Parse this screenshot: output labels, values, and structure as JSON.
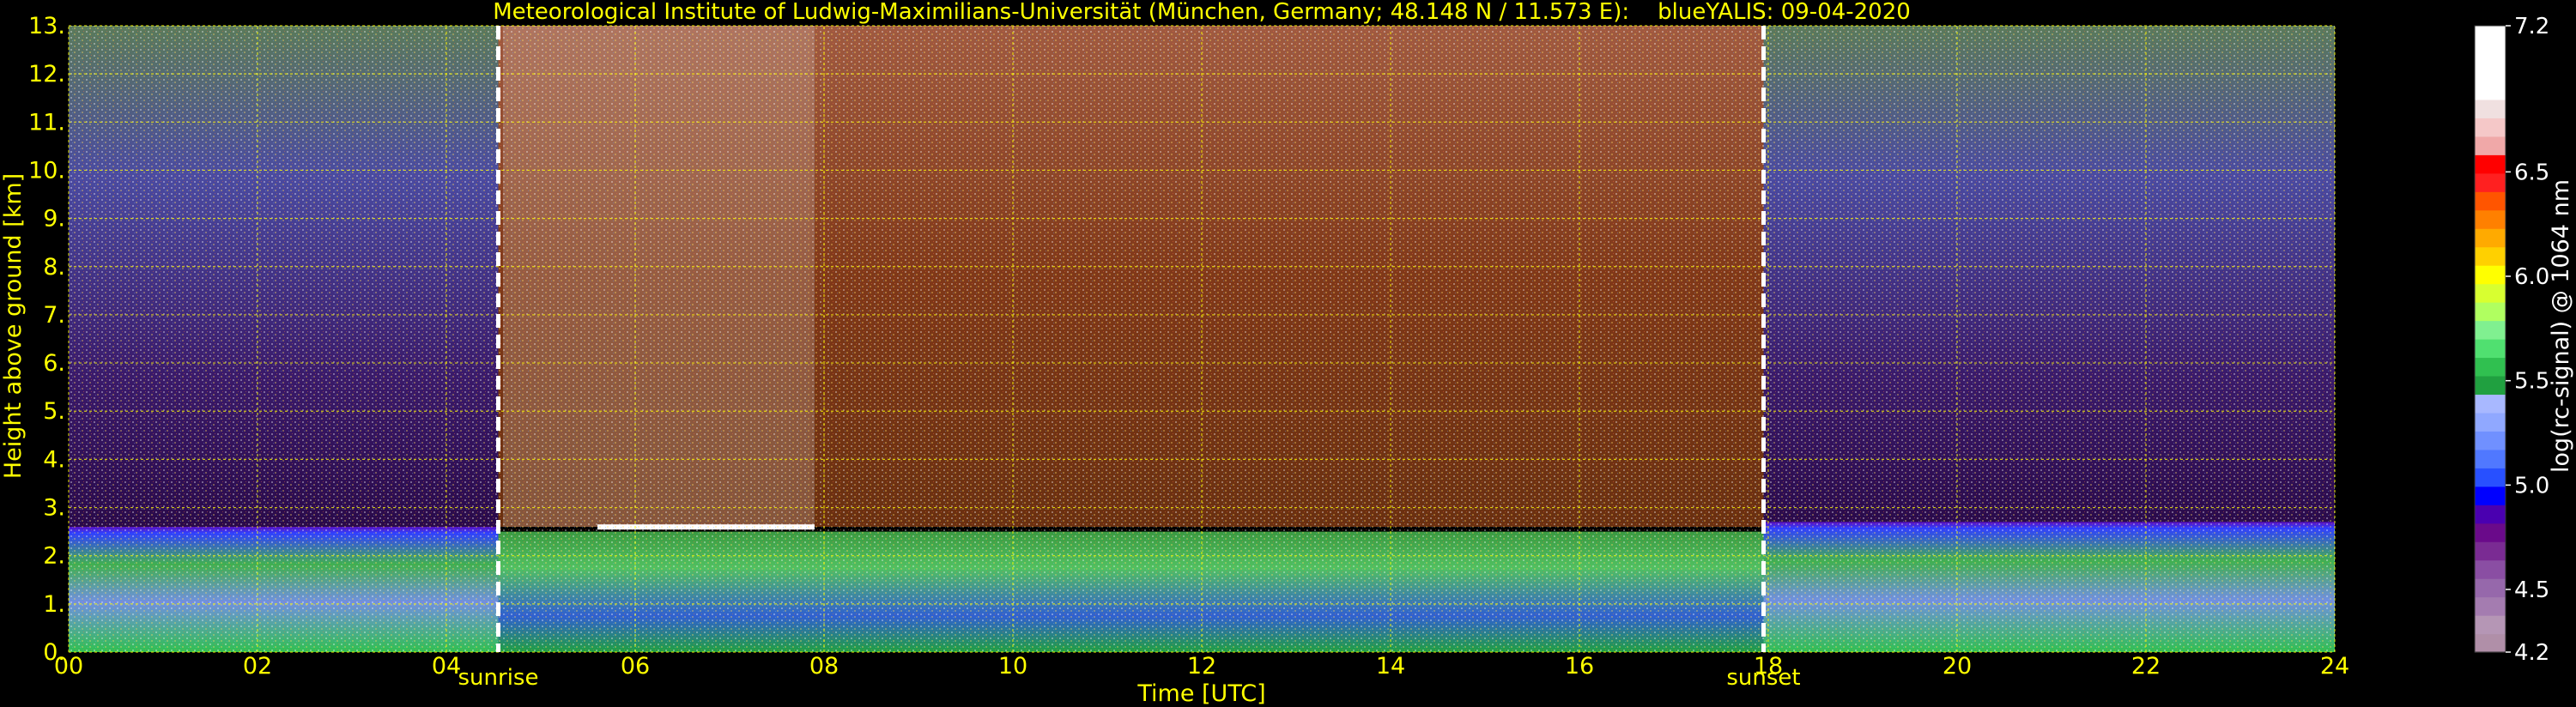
{
  "colors": {
    "background": "#000000",
    "text_yellow": "#ffff00",
    "grid": "#ffff00",
    "marker_line": "#ffffff",
    "colorbar_text": "#ffffff"
  },
  "chart_data": {
    "type": "heatmap",
    "title": "Meteorological Institute of Ludwig-Maximilians-Universität (München, Germany; 48.148 N / 11.573 E):    blueYALIS: 09-04-2020",
    "xlabel": "Time [UTC]",
    "ylabel": "Height above ground [km]",
    "xlim": [
      0,
      24
    ],
    "ylim": [
      0,
      13
    ],
    "x_ticks": [
      "00",
      "02",
      "04",
      "06",
      "08",
      "10",
      "12",
      "14",
      "16",
      "18",
      "20",
      "22",
      "24"
    ],
    "y_ticks": [
      "0.",
      "1.",
      "2.",
      "3.",
      "4.",
      "5.",
      "6.",
      "7.",
      "8.",
      "9.",
      "10.",
      "11.",
      "12.",
      "13."
    ],
    "grid": true,
    "annotations": [
      {
        "label": "sunrise",
        "x": 4.55
      },
      {
        "label": "sunset",
        "x": 17.95
      }
    ],
    "colorbar": {
      "label": "log(rc-signal) @ 1064 nm",
      "range": [
        4.2,
        7.2
      ],
      "ticks": [
        "4.2",
        "4.5",
        "5.0",
        "5.5",
        "6.0",
        "6.5",
        "7.2"
      ],
      "tick_values": [
        4.2,
        4.5,
        5.0,
        5.5,
        6.0,
        6.5,
        7.2
      ],
      "colors": [
        "#b08fa8",
        "#b596b5",
        "#a47cb0",
        "#9668ab",
        "#8a4ea3",
        "#7a2b93",
        "#6a0a8a",
        "#4a00b0",
        "#0000ff",
        "#2850ff",
        "#5078ff",
        "#7090ff",
        "#90a8ff",
        "#a8b8ff",
        "#20a040",
        "#30c050",
        "#50e070",
        "#80f090",
        "#b0ff60",
        "#d8ff30",
        "#ffff00",
        "#ffd000",
        "#ffaa00",
        "#ff8000",
        "#ff5500",
        "#ff2020",
        "#ff0000",
        "#f0a8a8",
        "#f5c8c8",
        "#f0e0e0",
        "#ffffff",
        "#ffffff",
        "#ffffff",
        "#ffffff"
      ]
    },
    "field_description": [
      {
        "x": [
          0,
          4.55
        ],
        "y": [
          2.6,
          13
        ],
        "level": "low (~4.8-5.2)"
      },
      {
        "x": [
          4.55,
          17.95
        ],
        "y": [
          2.6,
          13
        ],
        "level": "high (~5.8-6.5)"
      },
      {
        "x": [
          17.95,
          24
        ],
        "y": [
          2.6,
          13
        ],
        "level": "low (~4.8-5.2)"
      },
      {
        "x": [
          0,
          24
        ],
        "y": [
          0,
          2.6
        ],
        "level": "boundary layer (~5.0-5.6)"
      }
    ]
  }
}
